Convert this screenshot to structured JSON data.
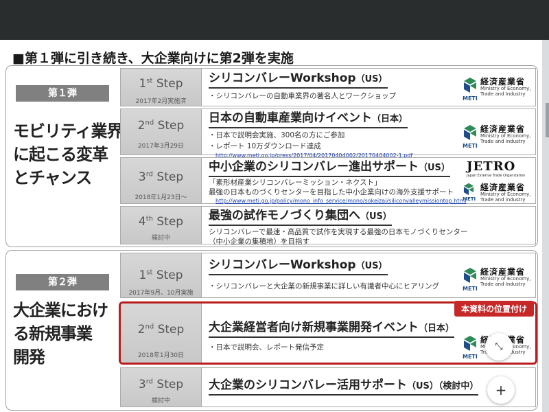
{
  "slide_title": "■第１弾に引き続き、大企業向けに第2弾を実施",
  "phase1": {
    "label": "第１弾",
    "heading": "モビリティ業界\nに起こる変革\nとチャンス",
    "steps": [
      {
        "num": "1",
        "ord": "st",
        "word": "Step",
        "date": "2017年2月実施済",
        "title": "シリコンバレーWorkshop",
        "title_sub": "（US）",
        "desc": [
          "・シリコンバレーの自動車業界の著名人とワークショップ"
        ],
        "link": ""
      },
      {
        "num": "2",
        "ord": "nd",
        "word": "Step",
        "date": "2017年3月29日",
        "title": "日本の自動車産業向けイベント",
        "title_sub": "（日本）",
        "desc": [
          "・日本で説明会実施、300名の方にご参加",
          "・レポート 10万ダウンロード達成"
        ],
        "link": "http://www.meti.go.jp/press/2017/04/20170404002/20170404002-1.pdf"
      },
      {
        "num": "3",
        "ord": "rd",
        "word": "Step",
        "date": "2018年1月23日～",
        "title": "中小企業のシリコンバレー進出サポート",
        "title_sub": "（US）",
        "desc": [
          "「素形材産業シリコンバレーミッション・ネクスト」",
          "最強の日本ものづくりセンターを目指した中小企業向けの海外支援サポート"
        ],
        "link": "http://www.meti.go.jp/policy/mono_info_service/mono/sokeizai/siliconvalleymissiontop.html"
      },
      {
        "num": "4",
        "ord": "th",
        "word": "Step",
        "date": "検討中",
        "title": "最強の試作モノづくり集団へ",
        "title_sub": "（US）",
        "desc": [
          "シリコンバレーで最速・高品質で試作を実現する最強の日本モノづくりセンター",
          "（中小企業の集積地）を目指す"
        ],
        "link": ""
      }
    ]
  },
  "phase2": {
    "label": "第２弾",
    "heading": "大企業におけ\nる新規事業\n開発",
    "badge": "本資料の位置付け",
    "steps": [
      {
        "num": "1",
        "ord": "st",
        "word": "Step",
        "date": "2017年9月、10月実施",
        "title": "シリコンバレーWorkshop",
        "title_sub": "（US）",
        "desc": [
          "・シリコンバレーと大企業の新規事業に詳しい有識者中心にヒアリング"
        ],
        "link": ""
      },
      {
        "num": "2",
        "ord": "nd",
        "word": "Step",
        "date": "2018年1月30日",
        "title": "大企業経営者向け新規事業開発イベント",
        "title_sub": "（日本）",
        "desc": [
          "・日本で説明会、レポート発信予定"
        ],
        "link": ""
      },
      {
        "num": "3",
        "ord": "rd",
        "word": "Step",
        "date": "検討中",
        "title": "大企業のシリコンバレー活用サポート",
        "title_sub": "（US）（検討中）",
        "desc": [],
        "link": ""
      }
    ]
  },
  "meti": {
    "ja": "経済産業省",
    "en": "Ministry of Economy,\nTrade and Industry",
    "abbr": "METI"
  },
  "jetro": {
    "word": "JETRO",
    "sub": "Japan External Trade Organization"
  },
  "colors": {
    "top_bar": "#2a2d2e",
    "phase_label_bg": "#808080",
    "highlight": "#c62828",
    "link": "#1a3fb0",
    "meti_blue": "#1b4e8a",
    "meti_green": "#2e8b57"
  },
  "icons": {
    "fab_expand": "expand-icon",
    "fab_plus": "plus-icon"
  },
  "fab_plus_symbol": "+",
  "fab_expand_symbol": "⤡"
}
